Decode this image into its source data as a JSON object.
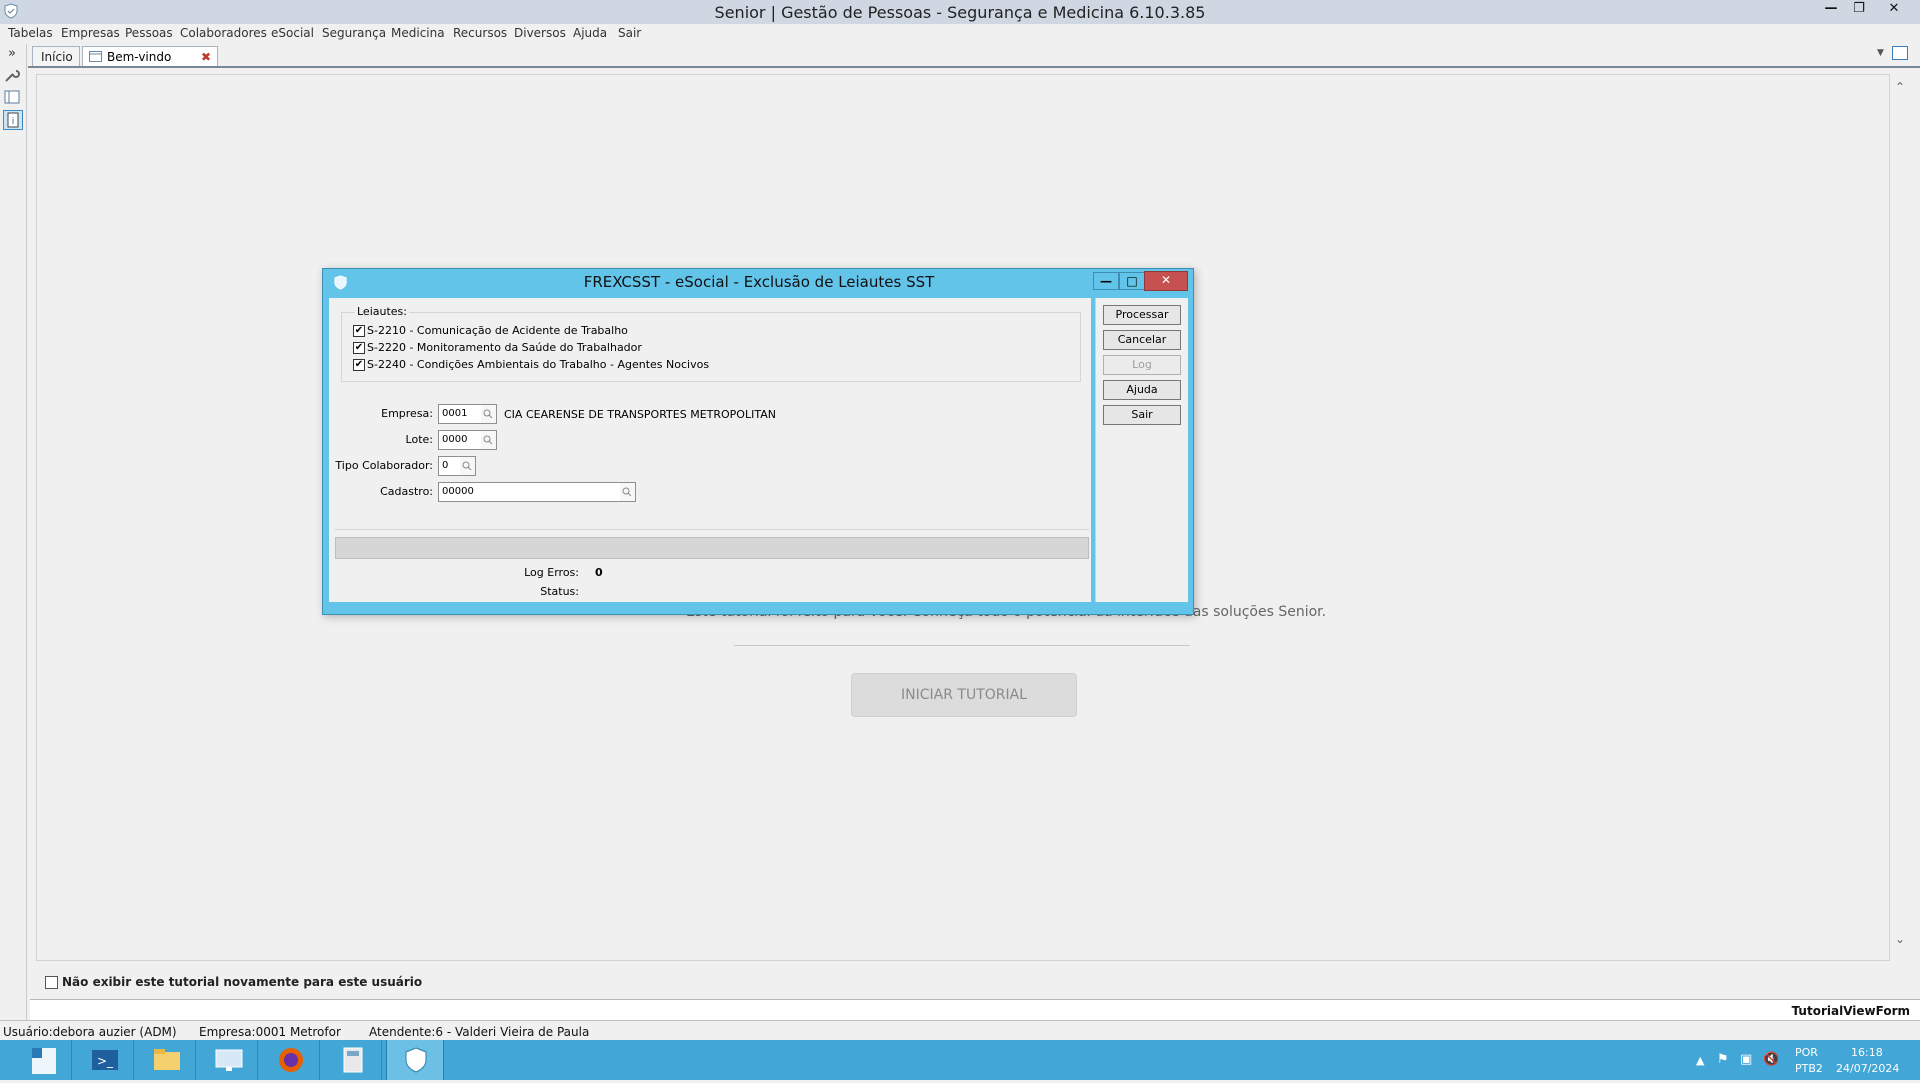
{
  "window": {
    "title": "Senior | Gestão de Pessoas - Segurança e Medicina 6.10.3.85",
    "controls": [
      "minimize-icon",
      "restore-icon",
      "close-icon"
    ]
  },
  "menu": [
    "Tabelas",
    "Empresas",
    "Pessoas",
    "Colaboradores",
    "eSocial",
    "Segurança",
    "Medicina",
    "Recursos",
    "Diversos",
    "Ajuda",
    "Sair"
  ],
  "tabs": {
    "inicio": "Início",
    "bemvindo": "Bem-vindo"
  },
  "welcome": {
    "intro_text": "Este tutorial foi feito para você. Conheça todo o potencial da interface das soluções Senior.",
    "start_button": "INICIAR TUTORIAL",
    "hide_checkbox_label": "Não exibir este tutorial novamente para este usuário",
    "form_name": "TutorialViewForm"
  },
  "statusbar": {
    "user": "Usuário:debora auzier (ADM)",
    "company": "Empresa:0001  Metrofor",
    "attendant": "Atendente:6 - Valderi Vieira de Paula"
  },
  "dialog": {
    "title": "FREXCSST - eSocial - Exclusão de Leiautes SST",
    "group_title": "Leiautes:",
    "layouts": [
      {
        "label": "S-2210 - Comunicação de Acidente de Trabalho",
        "checked": true
      },
      {
        "label": "S-2220 - Monitoramento da Saúde do Trabalhador",
        "checked": true
      },
      {
        "label": "S-2240 - Condições Ambientais do Trabalho - Agentes Nocivos",
        "checked": true
      }
    ],
    "fields": {
      "empresa_label": "Empresa:",
      "empresa_value": "0001",
      "empresa_name": "CIA CEARENSE DE TRANSPORTES METROPOLITAN",
      "lote_label": "Lote:",
      "lote_value": "0000",
      "tipo_label": "Tipo Colaborador:",
      "tipo_value": "0",
      "cadastro_label": "Cadastro:",
      "cadastro_value": "00000"
    },
    "log_errors_label": "Log Erros:",
    "log_errors_value": "0",
    "status_label": "Status:",
    "status_value": "",
    "buttons": {
      "processar": "Processar",
      "cancelar": "Cancelar",
      "log": "Log",
      "ajuda": "Ajuda",
      "sair": "Sair"
    }
  },
  "taskbar": {
    "apps": [
      "server-manager-icon",
      "powershell-icon",
      "file-explorer-icon",
      "remote-desktop-icon",
      "firefox-icon",
      "calculator-icon",
      "senior-app-icon"
    ],
    "language": "POR",
    "keyboard": "PTB2",
    "time": "16:18",
    "date": "24/07/2024"
  },
  "colors": {
    "dialog_frame": "#63c4ea",
    "taskbar": "#42a7d6",
    "close_button": "#c75050"
  }
}
